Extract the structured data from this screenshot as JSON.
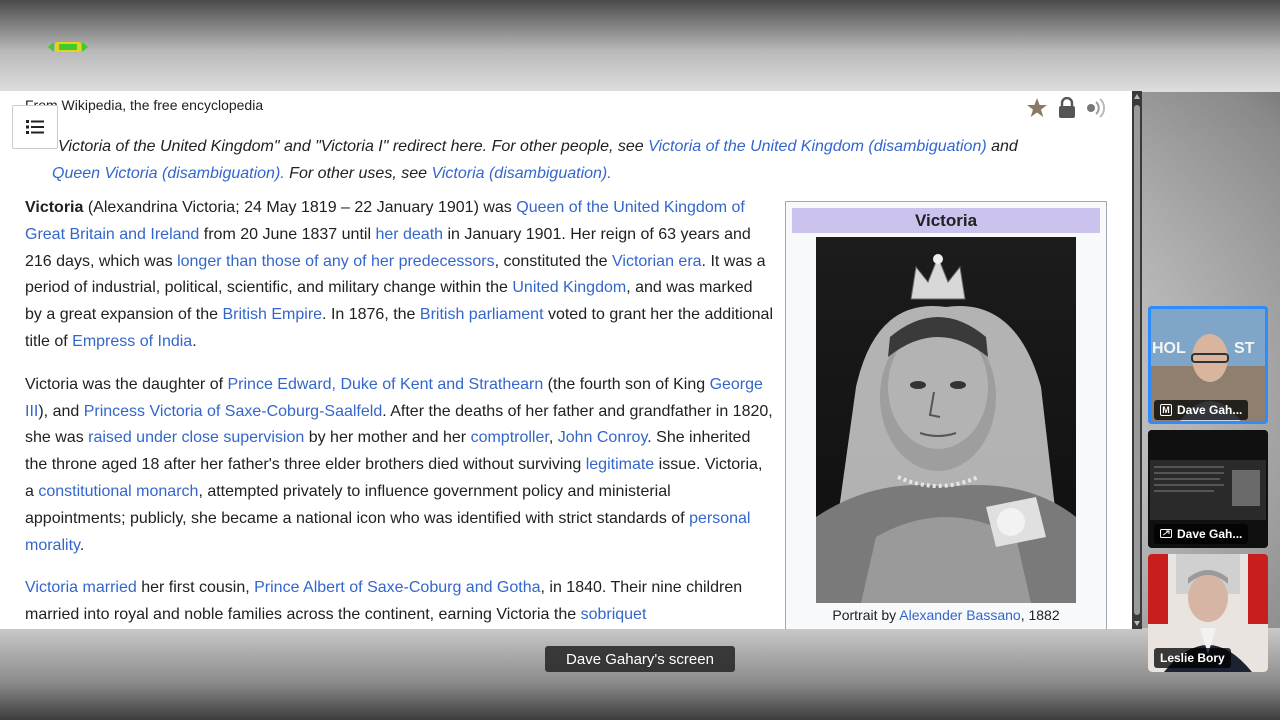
{
  "shared_content": {
    "from_line": "From Wikipedia, the free encyclopedia",
    "hatnote": {
      "p1_pre": "Victoria of the United Kingdom\" and \"Victoria I\" redirect here. For other people, see ",
      "p1_link1": "Victoria of the United Kingdom (disambiguation)",
      "p1_mid": " and ",
      "p2_link2": "Queen Victoria (disambiguation).",
      "p2_mid": " For other uses, see ",
      "p2_link3": "Victoria (disambiguation)."
    },
    "paragraph1": {
      "bold": "Victoria",
      "t1": " (Alexandrina Victoria; 24 May 1819 – 22 January 1901) was ",
      "l1": "Queen of the United Kingdom of Great Britain and Ireland",
      "t2": " from 20 June 1837 until ",
      "l2": "her death",
      "t3": " in January 1901. Her reign of 63 years and 216 days, which was ",
      "l3": "longer than those of any of her predecessors",
      "t4": ", constituted the ",
      "l4": "Victorian era",
      "t5": ". It was a period of industrial, political, scientific, and military change within the ",
      "l5": "United Kingdom",
      "t6": ", and was marked by a great expansion of the ",
      "l6": "British Empire",
      "t7": ". In 1876, the ",
      "l7": "British parliament",
      "t8": " voted to grant her the additional title of ",
      "l8": "Empress of India",
      "t9": "."
    },
    "paragraph2": {
      "t1": "Victoria was the daughter of ",
      "l1": "Prince Edward, Duke of Kent and Strathearn",
      "t2": " (the fourth son of King ",
      "l2": "George III",
      "t3": "), and ",
      "l3": "Princess Victoria of Saxe-Coburg-Saalfeld",
      "t4": ". After the deaths of her father and grandfather in 1820, she was ",
      "l4": "raised under close supervision",
      "t5": " by her mother and her ",
      "l5": "comptroller",
      "t6": ", ",
      "l6": "John Conroy",
      "t7": ". She inherited the throne aged 18 after her father's three elder brothers died without surviving ",
      "l7": "legitimate",
      "t8": " issue. Victoria, a ",
      "l8": "constitutional monarch",
      "t9": ", attempted privately to influence government policy and ministerial appointments; publicly, she became a national icon who was identified with strict standards of ",
      "l9": "personal morality",
      "t10": "."
    },
    "paragraph3": {
      "l1": "Victoria married",
      "t1": " her first cousin, ",
      "l2": "Prince Albert of Saxe-Coburg and Gotha",
      "t2": ", in 1840. Their nine children married into royal and noble families across the continent, earning Victoria the ",
      "l3": "sobriquet"
    },
    "infobox": {
      "title": "Victoria",
      "caption_pre": "Portrait by ",
      "caption_link": "Alexander Bassano",
      "caption_post": ", 1882"
    }
  },
  "participants": [
    {
      "name": "Dave Gah...",
      "icon": "mic-muted-icon",
      "active": true
    },
    {
      "name": "Dave Gah...",
      "icon": "screen-share-icon",
      "active": false
    },
    {
      "name": "Leslie Bory",
      "icon": "",
      "active": false
    }
  ],
  "screen_label": "Dave Gahary's screen"
}
